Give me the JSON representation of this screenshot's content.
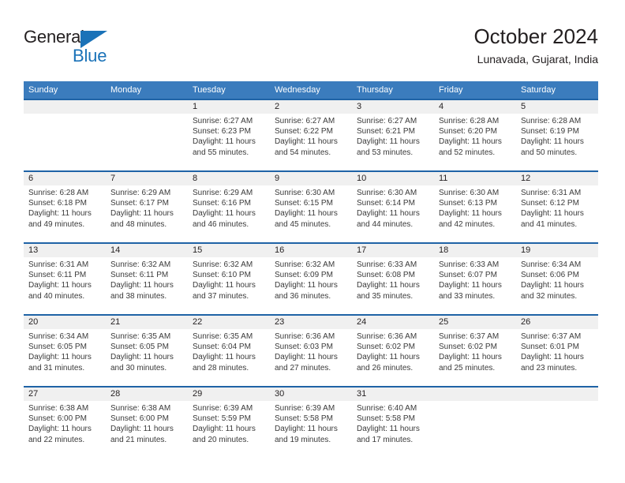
{
  "brand": {
    "name_part1": "General",
    "name_part2": "Blue",
    "triangle_color": "#1a72b8"
  },
  "header": {
    "title": "October 2024",
    "subtitle": "Lunavada, Gujarat, India",
    "header_bg": "#3b7cbd",
    "separator_color": "#1f63a6",
    "daynum_band_bg": "#f0f0f0"
  },
  "weekdays": [
    "Sunday",
    "Monday",
    "Tuesday",
    "Wednesday",
    "Thursday",
    "Friday",
    "Saturday"
  ],
  "labels": {
    "sunrise_prefix": "Sunrise: ",
    "sunset_prefix": "Sunset: ",
    "daylight_prefix": "Daylight: "
  },
  "weeks": [
    [
      {
        "day": "",
        "sunrise": "",
        "sunset": "",
        "daylight_line1": "",
        "daylight_line2": ""
      },
      {
        "day": "",
        "sunrise": "",
        "sunset": "",
        "daylight_line1": "",
        "daylight_line2": ""
      },
      {
        "day": "1",
        "sunrise": "Sunrise: 6:27 AM",
        "sunset": "Sunset: 6:23 PM",
        "daylight_line1": "Daylight: 11 hours",
        "daylight_line2": "and 55 minutes."
      },
      {
        "day": "2",
        "sunrise": "Sunrise: 6:27 AM",
        "sunset": "Sunset: 6:22 PM",
        "daylight_line1": "Daylight: 11 hours",
        "daylight_line2": "and 54 minutes."
      },
      {
        "day": "3",
        "sunrise": "Sunrise: 6:27 AM",
        "sunset": "Sunset: 6:21 PM",
        "daylight_line1": "Daylight: 11 hours",
        "daylight_line2": "and 53 minutes."
      },
      {
        "day": "4",
        "sunrise": "Sunrise: 6:28 AM",
        "sunset": "Sunset: 6:20 PM",
        "daylight_line1": "Daylight: 11 hours",
        "daylight_line2": "and 52 minutes."
      },
      {
        "day": "5",
        "sunrise": "Sunrise: 6:28 AM",
        "sunset": "Sunset: 6:19 PM",
        "daylight_line1": "Daylight: 11 hours",
        "daylight_line2": "and 50 minutes."
      }
    ],
    [
      {
        "day": "6",
        "sunrise": "Sunrise: 6:28 AM",
        "sunset": "Sunset: 6:18 PM",
        "daylight_line1": "Daylight: 11 hours",
        "daylight_line2": "and 49 minutes."
      },
      {
        "day": "7",
        "sunrise": "Sunrise: 6:29 AM",
        "sunset": "Sunset: 6:17 PM",
        "daylight_line1": "Daylight: 11 hours",
        "daylight_line2": "and 48 minutes."
      },
      {
        "day": "8",
        "sunrise": "Sunrise: 6:29 AM",
        "sunset": "Sunset: 6:16 PM",
        "daylight_line1": "Daylight: 11 hours",
        "daylight_line2": "and 46 minutes."
      },
      {
        "day": "9",
        "sunrise": "Sunrise: 6:30 AM",
        "sunset": "Sunset: 6:15 PM",
        "daylight_line1": "Daylight: 11 hours",
        "daylight_line2": "and 45 minutes."
      },
      {
        "day": "10",
        "sunrise": "Sunrise: 6:30 AM",
        "sunset": "Sunset: 6:14 PM",
        "daylight_line1": "Daylight: 11 hours",
        "daylight_line2": "and 44 minutes."
      },
      {
        "day": "11",
        "sunrise": "Sunrise: 6:30 AM",
        "sunset": "Sunset: 6:13 PM",
        "daylight_line1": "Daylight: 11 hours",
        "daylight_line2": "and 42 minutes."
      },
      {
        "day": "12",
        "sunrise": "Sunrise: 6:31 AM",
        "sunset": "Sunset: 6:12 PM",
        "daylight_line1": "Daylight: 11 hours",
        "daylight_line2": "and 41 minutes."
      }
    ],
    [
      {
        "day": "13",
        "sunrise": "Sunrise: 6:31 AM",
        "sunset": "Sunset: 6:11 PM",
        "daylight_line1": "Daylight: 11 hours",
        "daylight_line2": "and 40 minutes."
      },
      {
        "day": "14",
        "sunrise": "Sunrise: 6:32 AM",
        "sunset": "Sunset: 6:11 PM",
        "daylight_line1": "Daylight: 11 hours",
        "daylight_line2": "and 38 minutes."
      },
      {
        "day": "15",
        "sunrise": "Sunrise: 6:32 AM",
        "sunset": "Sunset: 6:10 PM",
        "daylight_line1": "Daylight: 11 hours",
        "daylight_line2": "and 37 minutes."
      },
      {
        "day": "16",
        "sunrise": "Sunrise: 6:32 AM",
        "sunset": "Sunset: 6:09 PM",
        "daylight_line1": "Daylight: 11 hours",
        "daylight_line2": "and 36 minutes."
      },
      {
        "day": "17",
        "sunrise": "Sunrise: 6:33 AM",
        "sunset": "Sunset: 6:08 PM",
        "daylight_line1": "Daylight: 11 hours",
        "daylight_line2": "and 35 minutes."
      },
      {
        "day": "18",
        "sunrise": "Sunrise: 6:33 AM",
        "sunset": "Sunset: 6:07 PM",
        "daylight_line1": "Daylight: 11 hours",
        "daylight_line2": "and 33 minutes."
      },
      {
        "day": "19",
        "sunrise": "Sunrise: 6:34 AM",
        "sunset": "Sunset: 6:06 PM",
        "daylight_line1": "Daylight: 11 hours",
        "daylight_line2": "and 32 minutes."
      }
    ],
    [
      {
        "day": "20",
        "sunrise": "Sunrise: 6:34 AM",
        "sunset": "Sunset: 6:05 PM",
        "daylight_line1": "Daylight: 11 hours",
        "daylight_line2": "and 31 minutes."
      },
      {
        "day": "21",
        "sunrise": "Sunrise: 6:35 AM",
        "sunset": "Sunset: 6:05 PM",
        "daylight_line1": "Daylight: 11 hours",
        "daylight_line2": "and 30 minutes."
      },
      {
        "day": "22",
        "sunrise": "Sunrise: 6:35 AM",
        "sunset": "Sunset: 6:04 PM",
        "daylight_line1": "Daylight: 11 hours",
        "daylight_line2": "and 28 minutes."
      },
      {
        "day": "23",
        "sunrise": "Sunrise: 6:36 AM",
        "sunset": "Sunset: 6:03 PM",
        "daylight_line1": "Daylight: 11 hours",
        "daylight_line2": "and 27 minutes."
      },
      {
        "day": "24",
        "sunrise": "Sunrise: 6:36 AM",
        "sunset": "Sunset: 6:02 PM",
        "daylight_line1": "Daylight: 11 hours",
        "daylight_line2": "and 26 minutes."
      },
      {
        "day": "25",
        "sunrise": "Sunrise: 6:37 AM",
        "sunset": "Sunset: 6:02 PM",
        "daylight_line1": "Daylight: 11 hours",
        "daylight_line2": "and 25 minutes."
      },
      {
        "day": "26",
        "sunrise": "Sunrise: 6:37 AM",
        "sunset": "Sunset: 6:01 PM",
        "daylight_line1": "Daylight: 11 hours",
        "daylight_line2": "and 23 minutes."
      }
    ],
    [
      {
        "day": "27",
        "sunrise": "Sunrise: 6:38 AM",
        "sunset": "Sunset: 6:00 PM",
        "daylight_line1": "Daylight: 11 hours",
        "daylight_line2": "and 22 minutes."
      },
      {
        "day": "28",
        "sunrise": "Sunrise: 6:38 AM",
        "sunset": "Sunset: 6:00 PM",
        "daylight_line1": "Daylight: 11 hours",
        "daylight_line2": "and 21 minutes."
      },
      {
        "day": "29",
        "sunrise": "Sunrise: 6:39 AM",
        "sunset": "Sunset: 5:59 PM",
        "daylight_line1": "Daylight: 11 hours",
        "daylight_line2": "and 20 minutes."
      },
      {
        "day": "30",
        "sunrise": "Sunrise: 6:39 AM",
        "sunset": "Sunset: 5:58 PM",
        "daylight_line1": "Daylight: 11 hours",
        "daylight_line2": "and 19 minutes."
      },
      {
        "day": "31",
        "sunrise": "Sunrise: 6:40 AM",
        "sunset": "Sunset: 5:58 PM",
        "daylight_line1": "Daylight: 11 hours",
        "daylight_line2": "and 17 minutes."
      },
      {
        "day": "",
        "sunrise": "",
        "sunset": "",
        "daylight_line1": "",
        "daylight_line2": ""
      },
      {
        "day": "",
        "sunrise": "",
        "sunset": "",
        "daylight_line1": "",
        "daylight_line2": ""
      }
    ]
  ]
}
